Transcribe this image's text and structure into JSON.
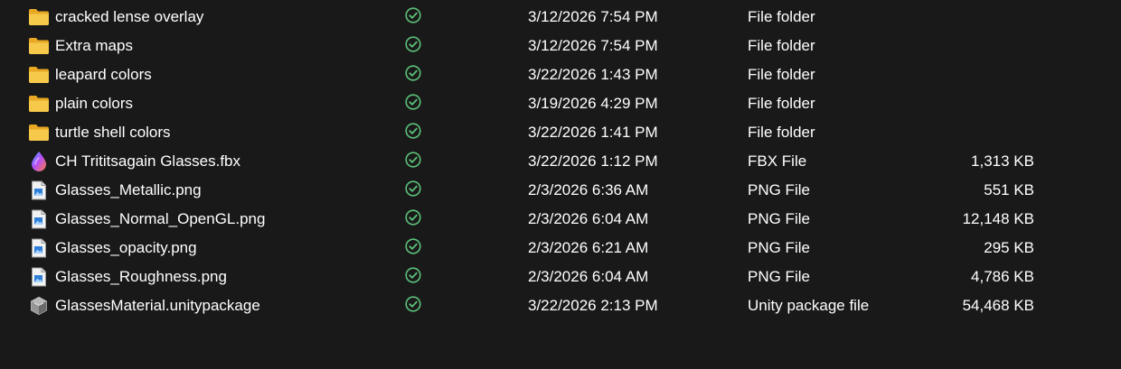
{
  "colors": {
    "background": "#191919",
    "text": "#ffffff",
    "folder": "#f5c342",
    "status_ok": "#5cc27a"
  },
  "files": [
    {
      "name": "cracked lense overlay",
      "icon": "folder-icon",
      "status": "available-icon",
      "date": "3/12/2026 7:54 PM",
      "type": "File folder",
      "size": ""
    },
    {
      "name": "Extra maps",
      "icon": "folder-icon",
      "status": "available-icon",
      "date": "3/12/2026 7:54 PM",
      "type": "File folder",
      "size": ""
    },
    {
      "name": "leapard colors",
      "icon": "folder-icon",
      "status": "available-icon",
      "date": "3/22/2026 1:43 PM",
      "type": "File folder",
      "size": ""
    },
    {
      "name": "plain colors",
      "icon": "folder-icon",
      "status": "available-icon",
      "date": "3/19/2026 4:29 PM",
      "type": "File folder",
      "size": ""
    },
    {
      "name": "turtle shell colors",
      "icon": "folder-icon",
      "status": "available-icon",
      "date": "3/22/2026 1:41 PM",
      "type": "File folder",
      "size": ""
    },
    {
      "name": "CH Trititsagain Glasses.fbx",
      "icon": "fbx-file-icon",
      "status": "available-icon",
      "date": "3/22/2026 1:12 PM",
      "type": "FBX File",
      "size": "1,313 KB"
    },
    {
      "name": "Glasses_Metallic.png",
      "icon": "image-file-icon",
      "status": "available-icon",
      "date": "2/3/2026 6:36 AM",
      "type": "PNG File",
      "size": "551 KB"
    },
    {
      "name": "Glasses_Normal_OpenGL.png",
      "icon": "image-file-icon",
      "status": "available-icon",
      "date": "2/3/2026 6:04 AM",
      "type": "PNG File",
      "size": "12,148 KB"
    },
    {
      "name": "Glasses_opacity.png",
      "icon": "image-file-icon",
      "status": "available-icon",
      "date": "2/3/2026 6:21 AM",
      "type": "PNG File",
      "size": "295 KB"
    },
    {
      "name": "Glasses_Roughness.png",
      "icon": "image-file-icon",
      "status": "available-icon",
      "date": "2/3/2026 6:04 AM",
      "type": "PNG File",
      "size": "4,786 KB"
    },
    {
      "name": "GlassesMaterial.unitypackage",
      "icon": "unity-package-icon",
      "status": "available-icon",
      "date": "3/22/2026 2:13 PM",
      "type": "Unity package file",
      "size": "54,468 KB"
    }
  ]
}
